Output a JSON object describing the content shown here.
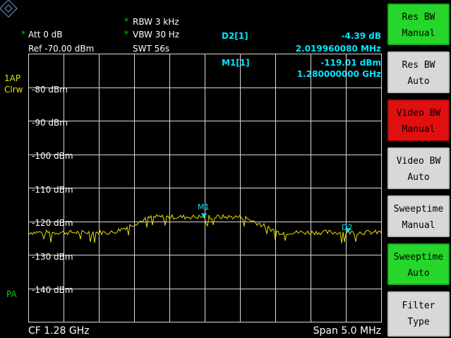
{
  "header": {
    "rbw": "RBW 3 kHz",
    "vbw": "VBW 30 Hz",
    "att": "Att  0 dB",
    "swt": "SWT 56s",
    "ref": "Ref  -70.00 dBm",
    "star": "*"
  },
  "markers": {
    "d2_label": "D2[1]",
    "d2_value": "-4.39 dB",
    "d2_freq": "2.019960080 MHz",
    "m1_label": "M1[1]",
    "m1_value": "-119.01 dBm",
    "m1_freq": "1.280000000 GHz",
    "m1_tag": "M1",
    "d2_tag": "D2"
  },
  "side_labels": {
    "trace": "1AP",
    "mode": "Clrw",
    "pa": "PA"
  },
  "yaxis": {
    "labels": [
      "-80 dBm",
      "-90 dBm",
      "-100 dBm",
      "-110 dBm",
      "-120 dBm",
      "-130 dBm",
      "-140 dBm"
    ]
  },
  "footer": {
    "cf": "CF 1.28 GHz",
    "span": "Span 5.0 MHz"
  },
  "softkeys": [
    {
      "line1": "Res BW",
      "line2": "Manual",
      "state": "green"
    },
    {
      "line1": "Res BW",
      "line2": "Auto",
      "state": "gray"
    },
    {
      "line1": "Video BW",
      "line2": "Manual",
      "state": "red"
    },
    {
      "line1": "Video BW",
      "line2": "Auto",
      "state": "gray"
    },
    {
      "line1": "Sweeptime",
      "line2": "Manual",
      "state": "gray"
    },
    {
      "line1": "Sweeptime",
      "line2": "Auto",
      "state": "green"
    },
    {
      "line1": "Filter",
      "line2": "Type",
      "state": "gray"
    }
  ],
  "colors": {
    "trace": "#e8e000",
    "marker": "#00e5ff",
    "grid": "#ffffff"
  }
}
